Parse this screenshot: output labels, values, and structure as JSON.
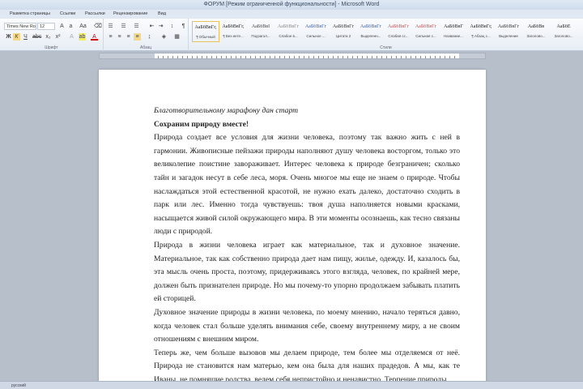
{
  "window": {
    "title": "ФОРУМ [Режим ограниченной функциональности]  -  Microsoft Word"
  },
  "tabs": [
    "Разметка страницы",
    "Ссылки",
    "Рассылки",
    "Рецензирование",
    "Вид"
  ],
  "ribbon": {
    "font_name": "Times New Ro",
    "font_size": "12",
    "groups": {
      "font": "Шрифт",
      "paragraph": "Абзац",
      "styles": "Стили"
    },
    "styles": [
      {
        "sample": "АаБбВвГг,",
        "name": "¶ Обычный",
        "color": "#222"
      },
      {
        "sample": "АаБбВвГг,",
        "name": "¶ Без инте...",
        "color": "#222"
      },
      {
        "sample": "АаБбВвІ",
        "name": "Подзагол...",
        "color": "#444"
      },
      {
        "sample": "АаБбВвГг",
        "name": "Слабое в...",
        "color": "#888"
      },
      {
        "sample": "АаБбВвГг",
        "name": "Сильное ...",
        "color": "#3a62a8"
      },
      {
        "sample": "АаБбВвГг",
        "name": "Цитата 2",
        "color": "#333"
      },
      {
        "sample": "АаБбВвГг",
        "name": "Выделенн...",
        "color": "#3a62a8"
      },
      {
        "sample": "АаБбВвГг",
        "name": "Слабая сс...",
        "color": "#c0504d"
      },
      {
        "sample": "АаБбВвГг",
        "name": "Сильная с...",
        "color": "#c0504d"
      },
      {
        "sample": "АаБбВвГ",
        "name": "Название...",
        "color": "#222"
      },
      {
        "sample": "АаБбВвГг,",
        "name": "¶ Абзац с...",
        "color": "#222"
      },
      {
        "sample": "АаБбВвГг",
        "name": "Выделение",
        "color": "#333"
      },
      {
        "sample": "АаБбВв",
        "name": "Заголово...",
        "color": "#222"
      },
      {
        "sample": "АаБбЕ",
        "name": "Заголово...",
        "color": "#222"
      }
    ]
  },
  "document": {
    "subtitle": "Благотворительному марафону дан старт",
    "heading": "Сохраним природу вместе!",
    "paragraphs": [
      "Природа создает все условия для жизни человека, поэтому так важно жить с ней в гармонии. Живописные пейзажи природы наполняют душу человека восторгом, только это великолепие поистине завораживает. Интерес человека к природе безграничен; сколько тайн и загадок несут в себе леса, моря. Очень многое мы еще не знаем о природе. Чтобы наслаждаться этой естественной красотой, не нужно ехать далеко, достаточно сходить в парк или лес. Именно тогда чувствуешь: твоя душа наполняется новыми красками, насыщается живой силой окружающего мира. В эти моменты осознаешь, как тесно связаны люди с природой.",
      "Природа в жизни человека играет как материальное, так и духовное значение. Материальное, так как собственно природа дает нам пищу, жилье, одежду. И, казалось бы, эта мысль очень проста, поэтому, придерживаясь этого взгляда, человек, по крайней мере, должен быть признателен природе. Но мы почему-то упорно продолжаем забывать платить ей сторицей.",
      "Духовное значение природы в жизни человека, по моему мнению, начало теряться давно, когда человек стал больше уделять внимания себе, своему внутреннему миру, а не своим отношениям с внешним миром.",
      "Теперь же, чем больше вызовов мы делаем природе, тем более мы отделяемся от неё. Природа не становится нам матерью, кем она была для наших прадедов. А мы, как те Иваны, не помнящие родства, ведем себя непристойно и ненавистно. Терпение природы"
    ]
  },
  "status": {
    "language": "русский"
  }
}
